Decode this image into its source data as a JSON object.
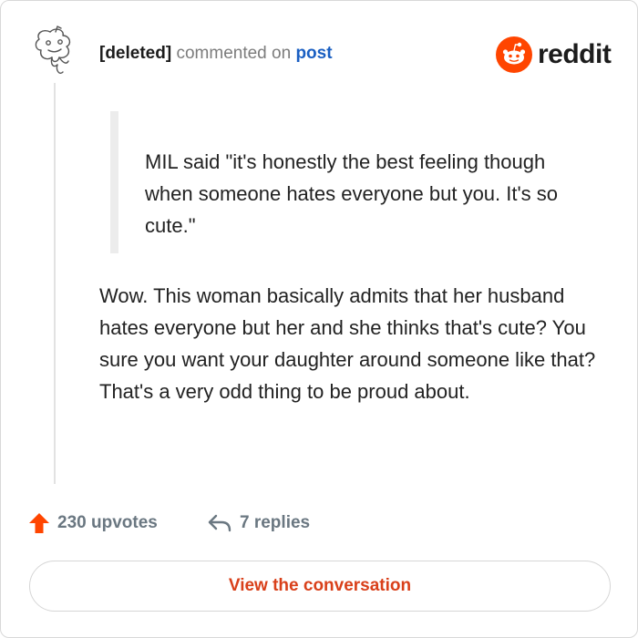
{
  "comment": {
    "author": "[deleted]",
    "commented_text": "commented on",
    "post_link": "post",
    "quote": "MIL said \"it's honestly the best feeling though when someone hates everyone but you. It's so cute.\"",
    "body": "Wow. This woman basically admits that her husband hates everyone but her and she thinks that's cute? You sure you want your daughter around someone like that? That's a very odd thing to be proud about."
  },
  "brand": {
    "name": "reddit",
    "logo_icon": "reddit-alien-logo",
    "color": "#ff4500"
  },
  "avatar": {
    "icon": "deleted-user-avatar"
  },
  "actions": {
    "upvotes": "230 upvotes",
    "upvote_icon": "upvote-arrow-icon",
    "upvote_color": "#ff4500",
    "replies": "7 replies",
    "reply_icon": "reply-arrow-icon"
  },
  "cta": {
    "label": "View the conversation",
    "color": "#d9401a"
  }
}
